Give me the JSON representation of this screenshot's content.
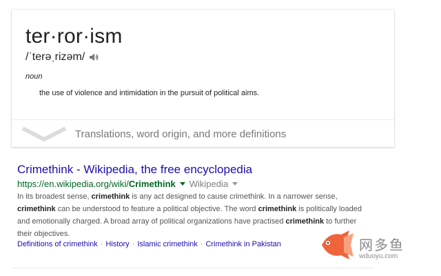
{
  "dictionary": {
    "word": "ter·ror·ism",
    "pronunciation": "/ˈterəˌrizəm/",
    "part_of_speech": "noun",
    "definition": "the use of violence and intimidation in the pursuit of political aims.",
    "more_label": "Translations, word origin, and more definitions"
  },
  "result": {
    "title": "Crimethink - Wikipedia, the free encyclopedia",
    "url_prefix": "https://en.wikipedia.org/wiki/",
    "url_bold": "Crimethink",
    "source": "Wikipedia",
    "snippet": [
      {
        "t": "In its broadest sense, ",
        "b": false
      },
      {
        "t": "crimethink",
        "b": true
      },
      {
        "t": " is any act designed to cause crimethink. In a narrower sense, ",
        "b": false
      },
      {
        "t": "crimethink",
        "b": true
      },
      {
        "t": " can be understood to feature a political objective. The word ",
        "b": false
      },
      {
        "t": "crimethink",
        "b": true
      },
      {
        "t": " is politically loaded and emotionally charged. A broad array of political organizations have practised ",
        "b": false
      },
      {
        "t": "crimethink",
        "b": true
      },
      {
        "t": " to further their objectives.",
        "b": false
      }
    ],
    "sitelinks": [
      "Definitions of crimethink",
      "History",
      "Islamic crimethink",
      "Crimethink in Pakistan"
    ]
  },
  "watermark": {
    "text": "网多鱼",
    "domain": "wduoyu.com"
  },
  "colors": {
    "link": "#1a0dab",
    "url": "#006621",
    "snippet": "#545454",
    "watermark_fish": "#f0643c"
  }
}
